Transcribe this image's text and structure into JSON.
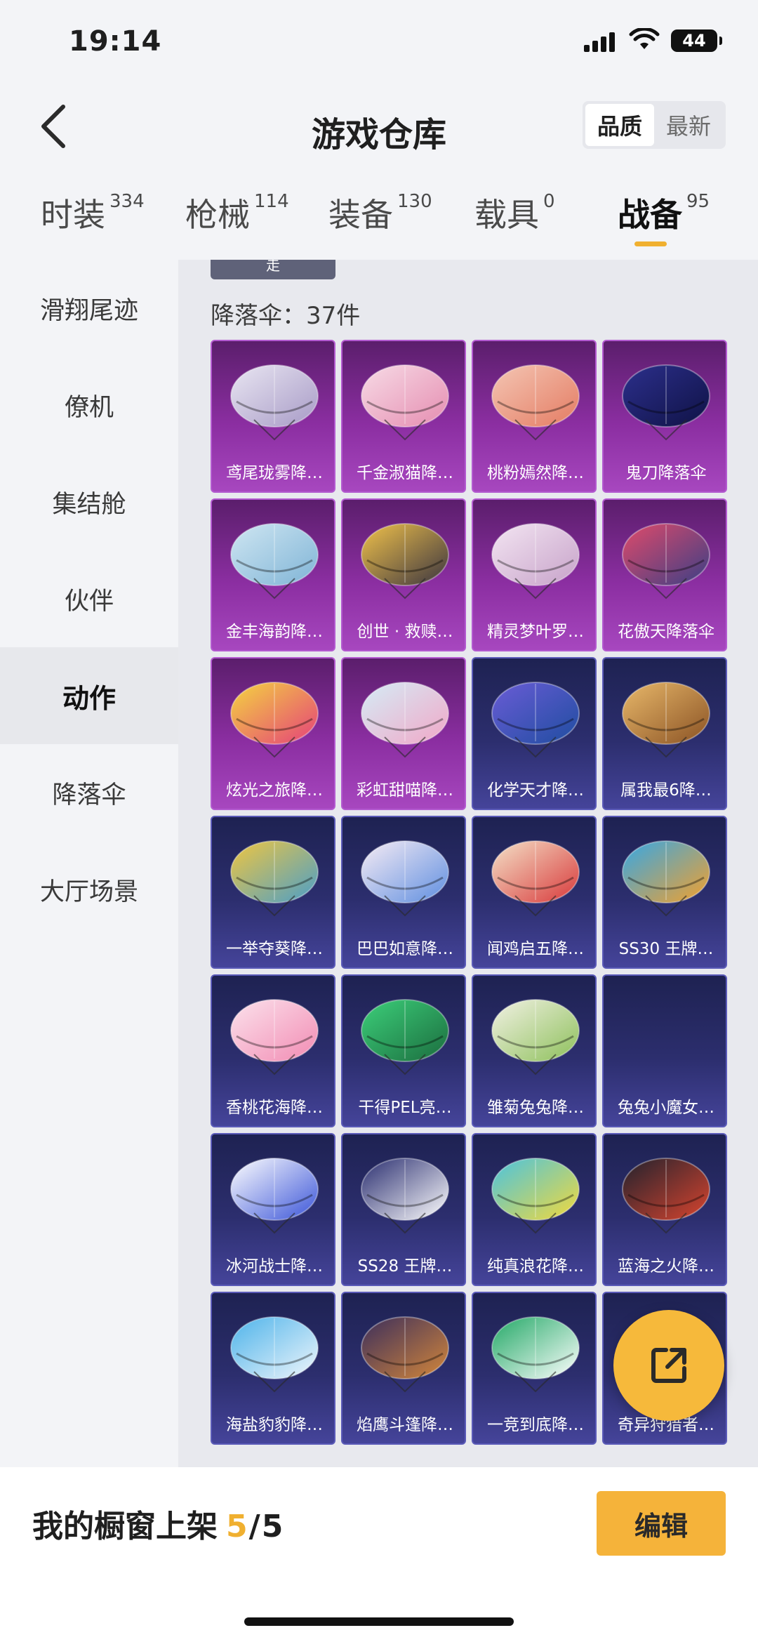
{
  "status_bar": {
    "time": "19:14",
    "battery": "44"
  },
  "header": {
    "title": "游戏仓库",
    "sort_options": [
      "品质",
      "最新"
    ],
    "active_sort": "品质"
  },
  "tabs": [
    {
      "label": "时装",
      "count": "334"
    },
    {
      "label": "枪械",
      "count": "114"
    },
    {
      "label": "装备",
      "count": "130"
    },
    {
      "label": "载具",
      "count": "0"
    },
    {
      "label": "战备",
      "count": "95"
    }
  ],
  "sidebar": {
    "items": [
      {
        "label": "滑翔尾迹"
      },
      {
        "label": "僚机"
      },
      {
        "label": "集结舱"
      },
      {
        "label": "伙伴"
      },
      {
        "label": "动作"
      },
      {
        "label": "降落伞"
      },
      {
        "label": "大厅场景"
      }
    ]
  },
  "content": {
    "prev_button": "走",
    "section_label": "降落伞：37件",
    "items": [
      {
        "name": "鸢尾珑雾降…",
        "rarity": "purple",
        "palette": [
          "#e9e6f2",
          "#a79ac6"
        ]
      },
      {
        "name": "千金淑猫降…",
        "rarity": "purple",
        "palette": [
          "#f7dbe6",
          "#e58cb0"
        ]
      },
      {
        "name": "桃粉嫣然降…",
        "rarity": "purple",
        "palette": [
          "#f4c6b4",
          "#e47b62"
        ]
      },
      {
        "name": "鬼刀降落伞",
        "rarity": "purple",
        "palette": [
          "#2c2f8c",
          "#0f1245"
        ]
      },
      {
        "name": "金丰海韵降…",
        "rarity": "purple",
        "palette": [
          "#cfe6f2",
          "#7fb4d6"
        ]
      },
      {
        "name": "创世 · 救赎…",
        "rarity": "purple",
        "palette": [
          "#f1c24a",
          "#3a3440"
        ]
      },
      {
        "name": "精灵梦叶罗…",
        "rarity": "purple",
        "palette": [
          "#f3e5f2",
          "#c7a2c9"
        ]
      },
      {
        "name": "花傲天降落伞",
        "rarity": "purple",
        "palette": [
          "#e04a6a",
          "#3a3f86"
        ]
      },
      {
        "name": "炫光之旅降…",
        "rarity": "purple",
        "palette": [
          "#f4d540",
          "#e5407a"
        ]
      },
      {
        "name": "彩虹甜喵降…",
        "rarity": "purple",
        "palette": [
          "#d4ecf6",
          "#f1a7c7"
        ]
      },
      {
        "name": "化学天才降…",
        "rarity": "blue",
        "palette": [
          "#6a5cd6",
          "#1f4da0"
        ]
      },
      {
        "name": "属我最6降…",
        "rarity": "blue",
        "palette": [
          "#e8b86a",
          "#8a5224"
        ]
      },
      {
        "name": "一举夺葵降…",
        "rarity": "blue",
        "palette": [
          "#f0c640",
          "#4a9ec9"
        ]
      },
      {
        "name": "巴巴如意降…",
        "rarity": "blue",
        "palette": [
          "#f7ecf4",
          "#5e8ee0"
        ]
      },
      {
        "name": "闻鸡启五降…",
        "rarity": "blue",
        "palette": [
          "#f4e2c8",
          "#d8383a"
        ]
      },
      {
        "name": "SS30 王牌…",
        "rarity": "blue",
        "palette": [
          "#35a7e6",
          "#f3a02c"
        ]
      },
      {
        "name": "香桃花海降…",
        "rarity": "blue",
        "palette": [
          "#fbe2ec",
          "#f28bb3"
        ]
      },
      {
        "name": "干得PEL亮…",
        "rarity": "blue",
        "palette": [
          "#3ccf7a",
          "#1b6c3e"
        ]
      },
      {
        "name": "雏菊兔兔降…",
        "rarity": "blue",
        "palette": [
          "#f2f1e4",
          "#8dc05a"
        ]
      },
      {
        "name": "兔兔小魔女…",
        "rarity": "blue",
        "palette": [
          "#2e2c6c",
          "#2e2c6c"
        ]
      },
      {
        "name": "冰河战士降…",
        "rarity": "blue",
        "palette": [
          "#ffffff",
          "#3a54d8"
        ]
      },
      {
        "name": "SS28 王牌…",
        "rarity": "blue",
        "palette": [
          "#2a2e70",
          "#ffffff"
        ]
      },
      {
        "name": "纯真浪花降…",
        "rarity": "blue",
        "palette": [
          "#4ac3e0",
          "#f3d93b"
        ]
      },
      {
        "name": "蓝海之火降…",
        "rarity": "blue",
        "palette": [
          "#20222e",
          "#d9442e"
        ]
      },
      {
        "name": "海盐豹豹降…",
        "rarity": "blue",
        "palette": [
          "#4db3ea",
          "#f0f6fb"
        ]
      },
      {
        "name": "焰鹰斗篷降…",
        "rarity": "blue",
        "palette": [
          "#3b2e5c",
          "#d4873a"
        ]
      },
      {
        "name": "一竞到底降…",
        "rarity": "blue",
        "palette": [
          "#22a866",
          "#ffffff"
        ]
      },
      {
        "name": "奇异狩猎者…",
        "rarity": "blue",
        "palette": [
          "#2e2c6c",
          "#2e2c6c"
        ]
      }
    ]
  },
  "bottom_bar": {
    "label": "我的橱窗上架",
    "current": "5",
    "total": "5",
    "edit_label": "编辑"
  }
}
